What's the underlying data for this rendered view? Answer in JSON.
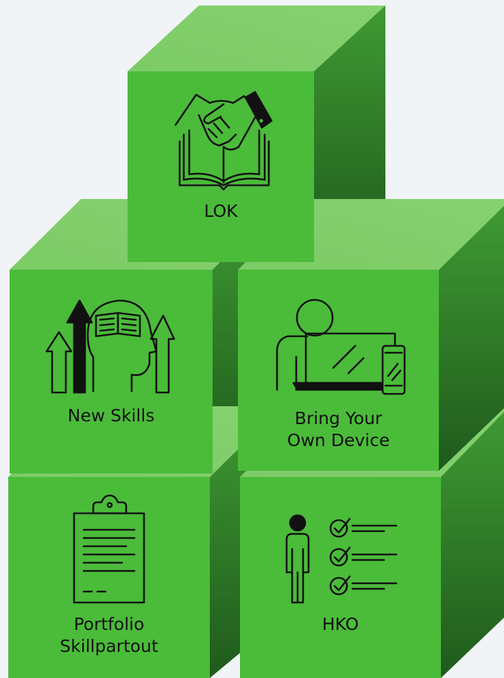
{
  "colors": {
    "background": "#f1f4f6",
    "front": "#4bbb3a",
    "top": "#82cf6c",
    "side_light": "#3f9a33",
    "side_dark": "#1f5a1c",
    "edge": "#2a7a24"
  },
  "cubes": [
    {
      "id": "lok",
      "label": "LOK",
      "icon": "handshake-book-icon"
    },
    {
      "id": "new-skills",
      "label": "New Skills",
      "icon": "head-growth-arrows-icon"
    },
    {
      "id": "byod",
      "label": "Bring Your\nOwn Device",
      "icon": "person-laptop-phone-icon"
    },
    {
      "id": "portfolio",
      "label": "Portfolio\nSkillpartout",
      "icon": "clipboard-icon"
    },
    {
      "id": "hko",
      "label": "HKO",
      "icon": "person-checklist-icon"
    }
  ]
}
